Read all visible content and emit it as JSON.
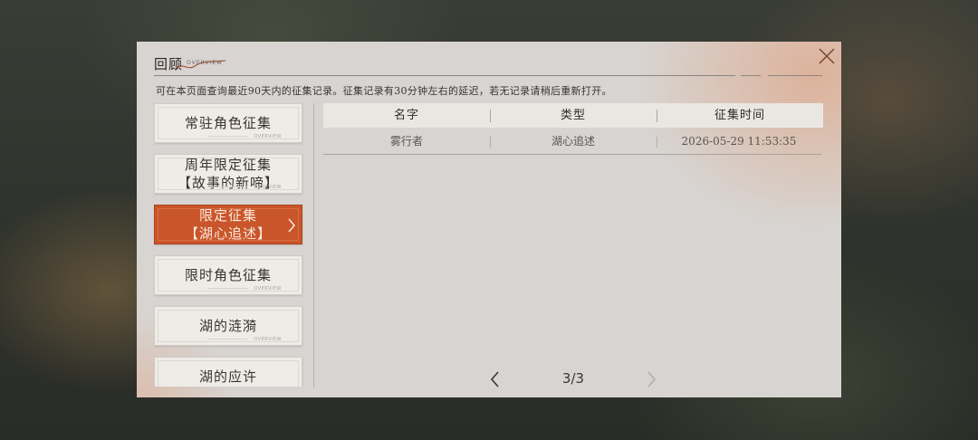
{
  "header": {
    "title": "回顾",
    "subtitle": "OVERVIEW"
  },
  "notice": "可在本页面查询最近90天内的征集记录。征集记录有30分钟左右的延迟，若无记录请稍后重新打开。",
  "sidebar": {
    "items": [
      {
        "label": "常驻角色征集",
        "active": false
      },
      {
        "label": "周年限定征集\n【故事的新啼】",
        "active": false
      },
      {
        "label": "限定征集\n【湖心追述】",
        "active": true
      },
      {
        "label": "限时角色征集",
        "active": false
      },
      {
        "label": "湖的涟漪",
        "active": false
      },
      {
        "label": "湖的应许",
        "active": false
      }
    ],
    "deco_right": "OVERVIEW"
  },
  "table": {
    "columns": [
      "名字",
      "类型",
      "征集时间"
    ],
    "rows": [
      [
        "雾行者",
        "湖心追述",
        "2026-05-29 11:53:35"
      ]
    ]
  },
  "pager": {
    "text": "3/3"
  },
  "colors": {
    "panel": "#d7d4d1",
    "accent": "#c9562a",
    "header_bg": "#eae7e3"
  },
  "icons": {
    "close": "close-icon",
    "prev": "chevron-left-icon",
    "next": "chevron-right-icon",
    "active_chevron": "chevron-right-icon"
  }
}
